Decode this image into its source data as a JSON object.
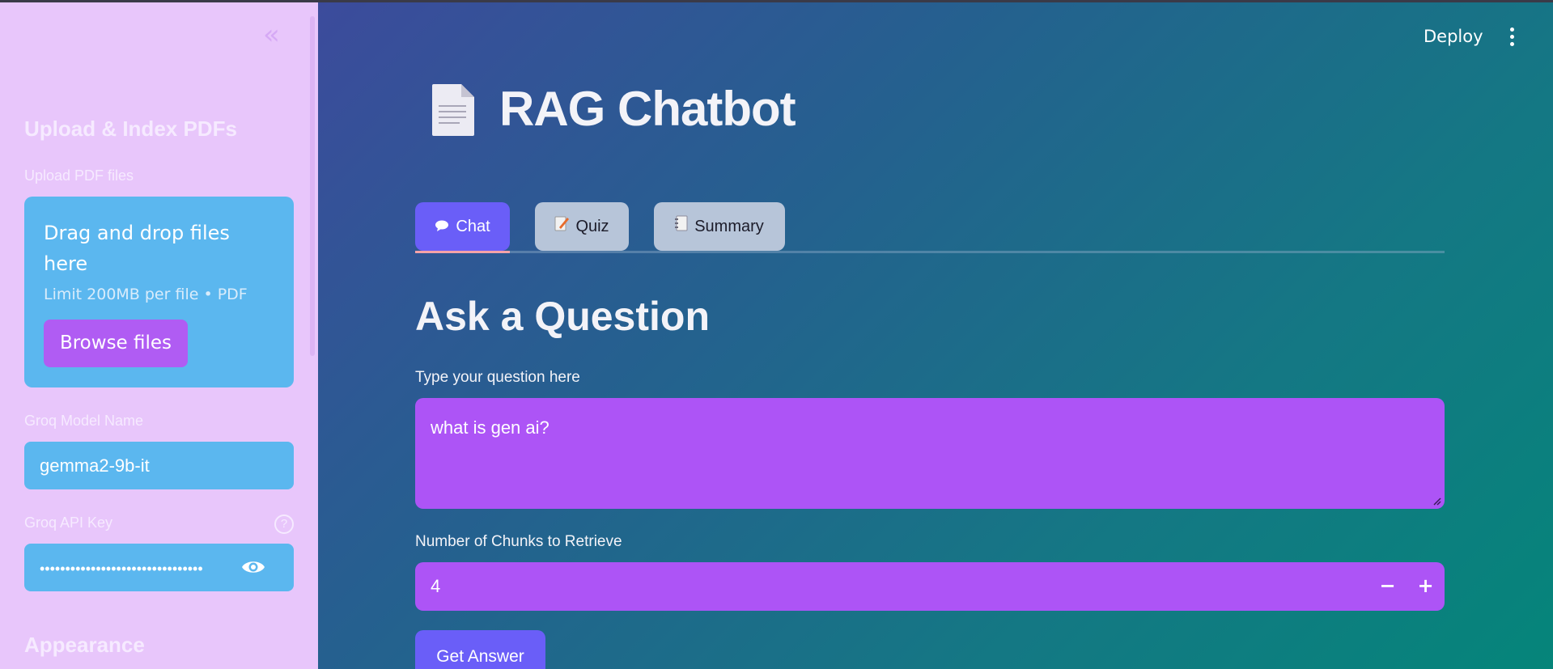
{
  "sidebar": {
    "collapse_label": "«",
    "upload_heading": "Upload & Index PDFs",
    "upload_label": "Upload PDF files",
    "dropzone": {
      "title": "Drag and drop files here",
      "limit": "Limit 200MB per file • PDF",
      "browse_label": "Browse files"
    },
    "model_label": "Groq Model Name",
    "model_value": "gemma2-9b-it",
    "api_key_label": "Groq API Key",
    "api_key_masked": "••••••••••••••••••••••••••••••••",
    "help_glyph": "?",
    "appearance_heading": "Appearance"
  },
  "header": {
    "deploy_label": "Deploy"
  },
  "main": {
    "title": "RAG Chatbot",
    "tabs": [
      {
        "label": "Chat",
        "icon": "speech-bubble-icon",
        "active": true
      },
      {
        "label": "Quiz",
        "icon": "memo-icon",
        "active": false
      },
      {
        "label": "Summary",
        "icon": "notebook-icon",
        "active": false
      }
    ],
    "section_title": "Ask a Question",
    "question_label": "Type your question here",
    "question_value": "what is gen ai?",
    "chunks_label": "Number of Chunks to Retrieve",
    "chunks_value": "4",
    "minus_label": "−",
    "plus_label": "+",
    "submit_label": "Get Answer"
  },
  "colors": {
    "sidebar_bg": "#e8c6fb",
    "input_blue": "#5bb7ef",
    "purple": "#ad54f6",
    "accent": "#6a5ef8"
  }
}
